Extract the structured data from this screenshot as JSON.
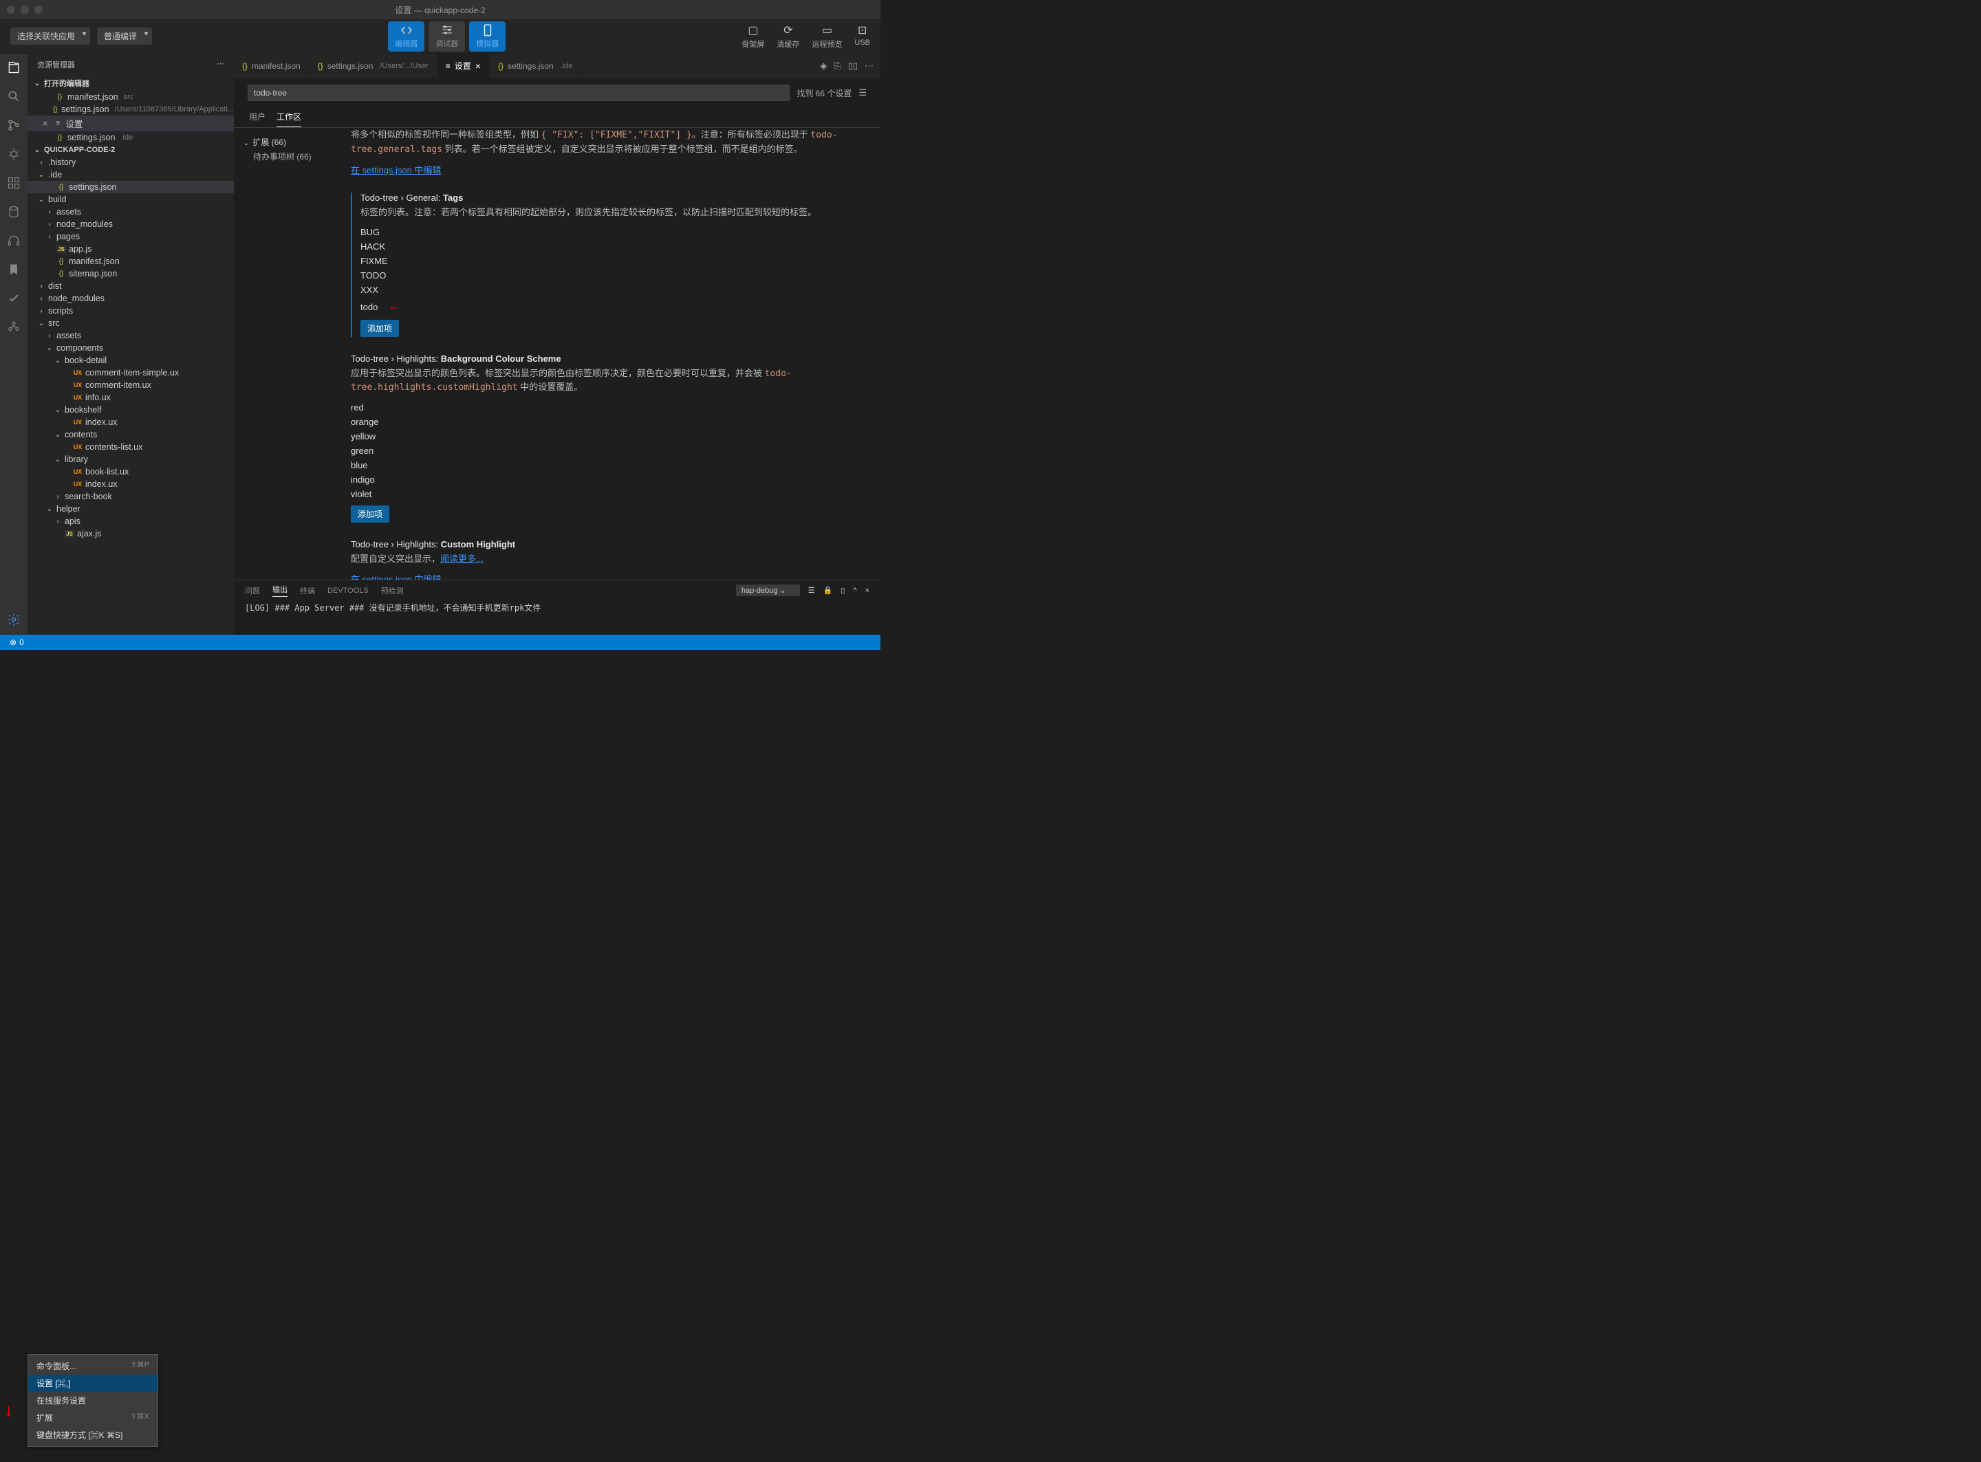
{
  "window_title": "设置 — quickapp-code-2",
  "toolbar": {
    "dropdown1": "选择关联快应用",
    "dropdown2": "普通编译",
    "modes": [
      {
        "label": "编辑器",
        "active": true
      },
      {
        "label": "调试器",
        "active": false
      },
      {
        "label": "模拟器",
        "active": true
      }
    ],
    "right_buttons": [
      {
        "label": "骨架屏"
      },
      {
        "label": "清缓存"
      },
      {
        "label": "远程预览"
      },
      {
        "label": "USB"
      }
    ]
  },
  "sidebar": {
    "title": "资源管理器",
    "open_editors": {
      "label": "打开的编辑器",
      "items": [
        {
          "name": "manifest.json",
          "detail": "src"
        },
        {
          "name": "settings.json",
          "detail": "/Users/11087385/Library/Applicati..."
        },
        {
          "name": "设置",
          "active": true,
          "closable": true,
          "icon": "settings"
        },
        {
          "name": "settings.json",
          "detail": ".ide"
        }
      ]
    },
    "project_name": "QUICKAPP-CODE-2",
    "tree": [
      {
        "type": "folder",
        "name": ".history",
        "expanded": false,
        "depth": 0
      },
      {
        "type": "folder",
        "name": ".ide",
        "expanded": true,
        "depth": 0
      },
      {
        "type": "file",
        "name": "settings.json",
        "icon": "json",
        "depth": 1,
        "selected": true
      },
      {
        "type": "folder",
        "name": "build",
        "expanded": true,
        "depth": 0
      },
      {
        "type": "folder",
        "name": "assets",
        "expanded": false,
        "depth": 1
      },
      {
        "type": "folder",
        "name": "node_modules",
        "expanded": false,
        "depth": 1
      },
      {
        "type": "folder",
        "name": "pages",
        "expanded": false,
        "depth": 1
      },
      {
        "type": "file",
        "name": "app.js",
        "icon": "js",
        "depth": 1
      },
      {
        "type": "file",
        "name": "manifest.json",
        "icon": "json",
        "depth": 1
      },
      {
        "type": "file",
        "name": "sitemap.json",
        "icon": "json",
        "depth": 1
      },
      {
        "type": "folder",
        "name": "dist",
        "expanded": false,
        "depth": 0
      },
      {
        "type": "folder",
        "name": "node_modules",
        "expanded": false,
        "depth": 0
      },
      {
        "type": "folder",
        "name": "scripts",
        "expanded": false,
        "depth": 0
      },
      {
        "type": "folder",
        "name": "src",
        "expanded": true,
        "depth": 0
      },
      {
        "type": "folder",
        "name": "assets",
        "expanded": false,
        "depth": 1
      },
      {
        "type": "folder",
        "name": "components",
        "expanded": true,
        "depth": 1
      },
      {
        "type": "folder",
        "name": "book-detail",
        "expanded": true,
        "depth": 2
      },
      {
        "type": "file",
        "name": "comment-item-simple.ux",
        "icon": "ux",
        "depth": 3
      },
      {
        "type": "file",
        "name": "comment-item.ux",
        "icon": "ux",
        "depth": 3
      },
      {
        "type": "file",
        "name": "info.ux",
        "icon": "ux",
        "depth": 3
      },
      {
        "type": "folder",
        "name": "bookshelf",
        "expanded": true,
        "depth": 2
      },
      {
        "type": "file",
        "name": "index.ux",
        "icon": "ux",
        "depth": 3
      },
      {
        "type": "folder",
        "name": "contents",
        "expanded": true,
        "depth": 2
      },
      {
        "type": "file",
        "name": "contents-list.ux",
        "icon": "ux",
        "depth": 3
      },
      {
        "type": "folder",
        "name": "library",
        "expanded": true,
        "depth": 2
      },
      {
        "type": "file",
        "name": "book-list.ux",
        "icon": "ux",
        "depth": 3
      },
      {
        "type": "file",
        "name": "index.ux",
        "icon": "ux",
        "depth": 3
      },
      {
        "type": "folder",
        "name": "search-book",
        "expanded": false,
        "depth": 2
      },
      {
        "type": "folder",
        "name": "helper",
        "expanded": true,
        "depth": 1
      },
      {
        "type": "folder",
        "name": "apis",
        "expanded": false,
        "depth": 2
      },
      {
        "type": "file",
        "name": "ajax.js",
        "icon": "js",
        "depth": 2
      }
    ]
  },
  "tabs": [
    {
      "label": "manifest.json",
      "icon": "json"
    },
    {
      "label": "settings.json",
      "detail": "/Users/.../User",
      "icon": "json"
    },
    {
      "label": "设置",
      "active": true,
      "icon": "settings",
      "closable": true
    },
    {
      "label": "settings.json",
      "detail": ".ide",
      "icon": "json"
    }
  ],
  "settings": {
    "search_value": "todo-tree",
    "search_result": "找到 66 个设置",
    "scope_tabs": {
      "user": "用户",
      "workspace": "工作区"
    },
    "toc": {
      "ext": "扩展 (66)",
      "todo": "待办事项树 (66)"
    },
    "top_setting": {
      "desc_pre": "将多个相似的标签视作同一种标签组类型，例如 ",
      "code1": "{ \"FIX\": [\"FIXME\",\"FIXIT\"] }",
      "desc_mid": "。注意：所有标签必须出现于 ",
      "code2": "todo-tree.general.tags",
      "desc_post": " 列表。若一个标签组被定义，自定义突出显示将被应用于整个标签组，而不是组内的标签。",
      "link": "在 settings.json 中编辑"
    },
    "tags_setting": {
      "title_prefix": "Todo-tree › General: ",
      "title_bold": "Tags",
      "desc": "标签的列表。注意：若两个标签具有相同的起始部分，则应该先指定较长的标签，以防止扫描时匹配到较短的标签。",
      "tags": [
        "BUG",
        "HACK",
        "FIXME",
        "TODO",
        "XXX",
        "todo"
      ],
      "add_btn": "添加项"
    },
    "colors_setting": {
      "title_prefix": "Todo-tree › Highlights: ",
      "title_bold": "Background Colour Scheme",
      "desc_pre": "应用于标签突出显示的颜色列表。标签突出显示的颜色由标签顺序决定，颜色在必要时可以重复，并会被 ",
      "code1": "todo-tree.highlights.customHighlight",
      "desc_post": " 中的设置覆盖。",
      "colors": [
        "red",
        "orange",
        "yellow",
        "green",
        "blue",
        "indigo",
        "violet"
      ],
      "add_btn": "添加项"
    },
    "custom_setting": {
      "title_prefix": "Todo-tree › Highlights: ",
      "title_bold": "Custom Highlight",
      "desc_pre": "配置自定义突出显示，",
      "read_more": "阅读更多...",
      "link": "在 settings.json 中编辑"
    }
  },
  "terminal": {
    "tabs": [
      "问题",
      "输出",
      "终端",
      "DEVTOOLS",
      "预检测"
    ],
    "active_tab": "输出",
    "select": "hap-debug",
    "log": "[LOG] ### App Server ### 没有记录手机地址，不会通知手机更新rpk文件"
  },
  "context_menu": {
    "items": [
      {
        "label": "命令面板...",
        "shortcut": "⇧⌘P"
      },
      {
        "label": "设置 [⌘,]",
        "shortcut": "",
        "highlighted": true
      },
      {
        "label": "在线服务设置",
        "shortcut": ""
      },
      {
        "label": "扩展",
        "shortcut": "⇧⌘X"
      },
      {
        "label": "键盘快捷方式 [⌘K ⌘S]",
        "shortcut": ""
      }
    ]
  }
}
